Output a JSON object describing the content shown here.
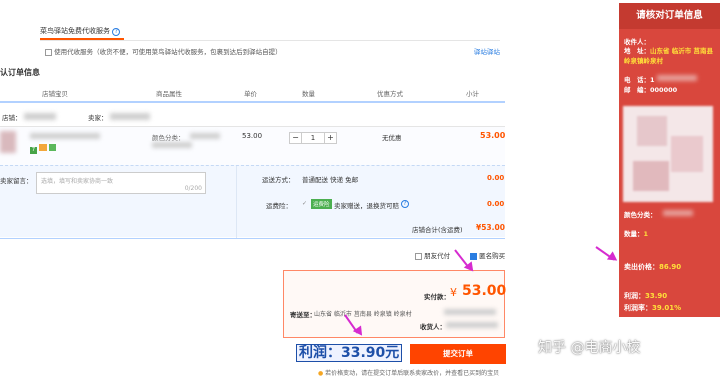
{
  "pickup_tab": {
    "label": "菜鸟驿站免费代收服务"
  },
  "pickup_option": {
    "label": "使用代收服务（收货不便，可使用菜鸟驿站代收服务，包裹到达后到驿站自提）",
    "link": "驿站驿站"
  },
  "order_section": {
    "title": "认订单信息"
  },
  "table_headers": [
    "店铺宝贝",
    "商品属性",
    "单价",
    "数量",
    "优惠方式",
    "小计"
  ],
  "store_row": {
    "shop_label": "店铺：",
    "seller_label": "卖家："
  },
  "item": {
    "attr_label": "颜色分类：",
    "price": "53.00",
    "quantity": "1",
    "discount": "无优惠",
    "subtotal": "53.00"
  },
  "message": {
    "label": "卖家留言：",
    "placeholder": "选填，填写和卖家协商一致",
    "counter": "0/200"
  },
  "shipping": {
    "label": "运送方式：",
    "value": "普通配送 快递 免邮",
    "price": "0.00"
  },
  "insurance": {
    "label": "运费险：",
    "badge": "运费险",
    "value": "卖家赠送，退换货可赔",
    "price": "0.00"
  },
  "store_total": {
    "label": "店铺合计(含运费)",
    "value": "¥53.00"
  },
  "options": {
    "friend_pay": "朋友代付",
    "anonymous": "匿名购买"
  },
  "summary": {
    "paid_label": "实付款：",
    "currency": "¥",
    "paid_value": "53.00",
    "ship_to_label": "寄送至：",
    "ship_to_value": "山东省 临沂市 莒南县 岭泉镇 岭泉村",
    "receiver_label": "收货人："
  },
  "profit_annotation": "利润：33.90元",
  "submit_button": "提交订单",
  "footer_note": "若价格变动，请在提交订单后联系卖家改价，并查看已买到的宝贝",
  "watermark": "知乎 @电商小校",
  "side_panel": {
    "title": "请核对订单信息",
    "receiver_label": "收件人：",
    "address_label": "地　址：",
    "address_value": "山东省 临沂市 莒南县",
    "address_line2": "岭泉镇岭泉村",
    "phone_label": "电　话：",
    "phone_value": "1",
    "postcode_label": "邮　编：",
    "postcode_value": "000000",
    "color_label": "颜色分类：",
    "qty_label": "数量：",
    "qty_value": "1",
    "sell_price_label": "卖出价格：",
    "sell_price_value": "86.90",
    "profit_label": "利润：",
    "profit_value": "33.90",
    "margin_label": "利润率：",
    "margin_value": "39.01%"
  },
  "colors": {
    "accent_orange": "#ff5500",
    "side_red": "#d9473d",
    "annotation_blue": "#1d4fa8",
    "arrow_magenta": "#d62bd0"
  }
}
